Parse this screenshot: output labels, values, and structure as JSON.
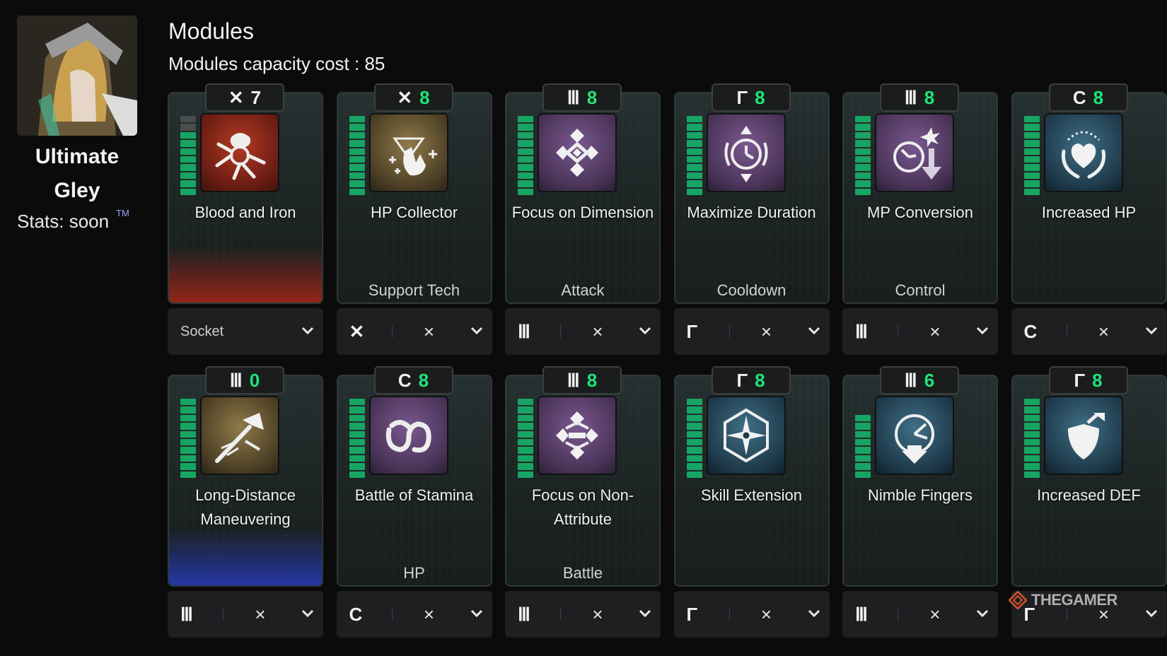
{
  "character": {
    "name": "Ultimate Gley",
    "stats": "Stats: soon",
    "superscript": "TM"
  },
  "header": {
    "title": "Modules",
    "capacity": "Modules capacity cost : 85"
  },
  "colors": {
    "accent_green": "#1ee47a",
    "level_green": "#17a563",
    "card_bg": "#1c2323",
    "socket_bg": "#1e1f21"
  },
  "modules": [
    {
      "name": "Blood and Iron",
      "type": "",
      "socket_symbol": "✕",
      "symbol_icon": "star-cross-icon",
      "capacity": "7",
      "capacity_highlight": false,
      "socket_label": "Socket",
      "level": 8,
      "level_max": 10,
      "icon": "blood-and-iron-icon",
      "bg": "red",
      "glow": "red"
    },
    {
      "name": "HP Collector",
      "type": "Support Tech",
      "socket_symbol": "✕",
      "symbol_icon": "star-cross-icon",
      "capacity": "8",
      "capacity_highlight": true,
      "socket_label": "",
      "level": 10,
      "level_max": 10,
      "icon": "hp-collector-icon",
      "bg": "gold",
      "glow": ""
    },
    {
      "name": "Focus on Dimension",
      "type": "Attack",
      "socket_symbol": "Ⅲ",
      "symbol_icon": "malachite-icon",
      "capacity": "8",
      "capacity_highlight": true,
      "socket_label": "",
      "level": 10,
      "level_max": 10,
      "icon": "focus-dimension-icon",
      "bg": "purple",
      "glow": ""
    },
    {
      "name": "Maximize Duration",
      "type": "Cooldown",
      "socket_symbol": "Γ",
      "symbol_icon": "rutile-icon",
      "capacity": "8",
      "capacity_highlight": true,
      "socket_label": "",
      "level": 10,
      "level_max": 10,
      "icon": "maximize-duration-icon",
      "bg": "purple",
      "glow": ""
    },
    {
      "name": "MP Conversion",
      "type": "Control",
      "socket_symbol": "Ⅲ",
      "symbol_icon": "malachite-icon",
      "capacity": "8",
      "capacity_highlight": true,
      "socket_label": "",
      "level": 10,
      "level_max": 10,
      "icon": "mp-conversion-icon",
      "bg": "purple",
      "glow": ""
    },
    {
      "name": "Increased HP",
      "type": "",
      "socket_symbol": "C",
      "symbol_icon": "cerulean-icon",
      "capacity": "8",
      "capacity_highlight": true,
      "socket_label": "",
      "level": 10,
      "level_max": 10,
      "icon": "increased-hp-icon",
      "bg": "teal",
      "glow": ""
    },
    {
      "name": "Long-Distance Maneuvering",
      "type": "",
      "socket_symbol": "Ⅲ",
      "symbol_icon": "malachite-icon",
      "capacity": "0",
      "capacity_highlight": true,
      "socket_label": "",
      "level": 10,
      "level_max": 10,
      "icon": "long-distance-icon",
      "bg": "gold",
      "glow": "blue"
    },
    {
      "name": "Battle of Stamina",
      "type": "HP",
      "socket_symbol": "C",
      "symbol_icon": "cerulean-icon",
      "capacity": "8",
      "capacity_highlight": true,
      "socket_label": "",
      "level": 10,
      "level_max": 10,
      "icon": "battle-stamina-icon",
      "bg": "purple",
      "glow": ""
    },
    {
      "name": "Focus on Non-Attribute",
      "type": "Battle",
      "socket_symbol": "Ⅲ",
      "symbol_icon": "malachite-icon",
      "capacity": "8",
      "capacity_highlight": true,
      "socket_label": "",
      "level": 10,
      "level_max": 10,
      "icon": "focus-non-attribute-icon",
      "bg": "purple",
      "glow": ""
    },
    {
      "name": "Skill Extension",
      "type": "",
      "socket_symbol": "Γ",
      "symbol_icon": "rutile-icon",
      "capacity": "8",
      "capacity_highlight": true,
      "socket_label": "",
      "level": 10,
      "level_max": 10,
      "icon": "skill-extension-icon",
      "bg": "teal",
      "glow": ""
    },
    {
      "name": "Nimble Fingers",
      "type": "",
      "socket_symbol": "Ⅲ",
      "symbol_icon": "malachite-icon",
      "capacity": "6",
      "capacity_highlight": true,
      "socket_label": "",
      "level": 8,
      "level_max": 10,
      "icon": "nimble-fingers-icon",
      "bg": "teal",
      "glow": ""
    },
    {
      "name": "Increased DEF",
      "type": "",
      "socket_symbol": "Γ",
      "symbol_icon": "rutile-icon",
      "capacity": "8",
      "capacity_highlight": true,
      "socket_label": "",
      "level": 10,
      "level_max": 10,
      "icon": "increased-def-icon",
      "bg": "teal",
      "glow": ""
    }
  ],
  "watermark": "THEGAMER"
}
